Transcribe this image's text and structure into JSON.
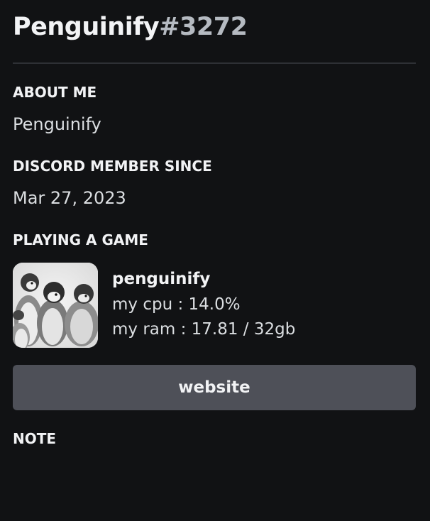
{
  "profile": {
    "username": "Penguinify",
    "discriminator": "#3272"
  },
  "about_me": {
    "heading": "ABOUT ME",
    "text": "Penguinify"
  },
  "member_since": {
    "heading": "DISCORD MEMBER SINCE",
    "date": "Mar 27, 2023"
  },
  "activity": {
    "heading": "PLAYING A GAME",
    "image_icon": "penguins-image",
    "name": "penguinify",
    "details": "my cpu : 14.0%",
    "state": "my ram : 17.81 / 32gb"
  },
  "buttons": {
    "website_label": "website"
  },
  "note": {
    "heading": "NOTE"
  },
  "colors": {
    "background": "#111214",
    "button": "#4e5058",
    "divider": "#2e3035",
    "discriminator": "#b5bac1"
  }
}
